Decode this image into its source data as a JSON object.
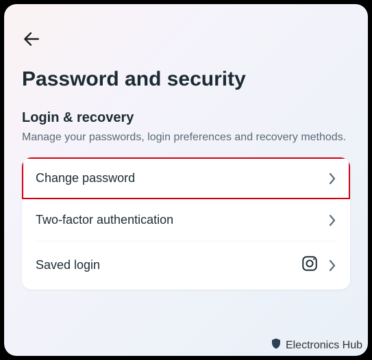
{
  "header": {
    "title": "Password and security"
  },
  "section": {
    "title": "Login & recovery",
    "description": "Manage your passwords, login preferences and recovery methods."
  },
  "rows": {
    "change_password": "Change password",
    "two_factor": "Two-factor authentication",
    "saved_login": "Saved login"
  },
  "watermark": {
    "text": "Electronics Hub"
  }
}
